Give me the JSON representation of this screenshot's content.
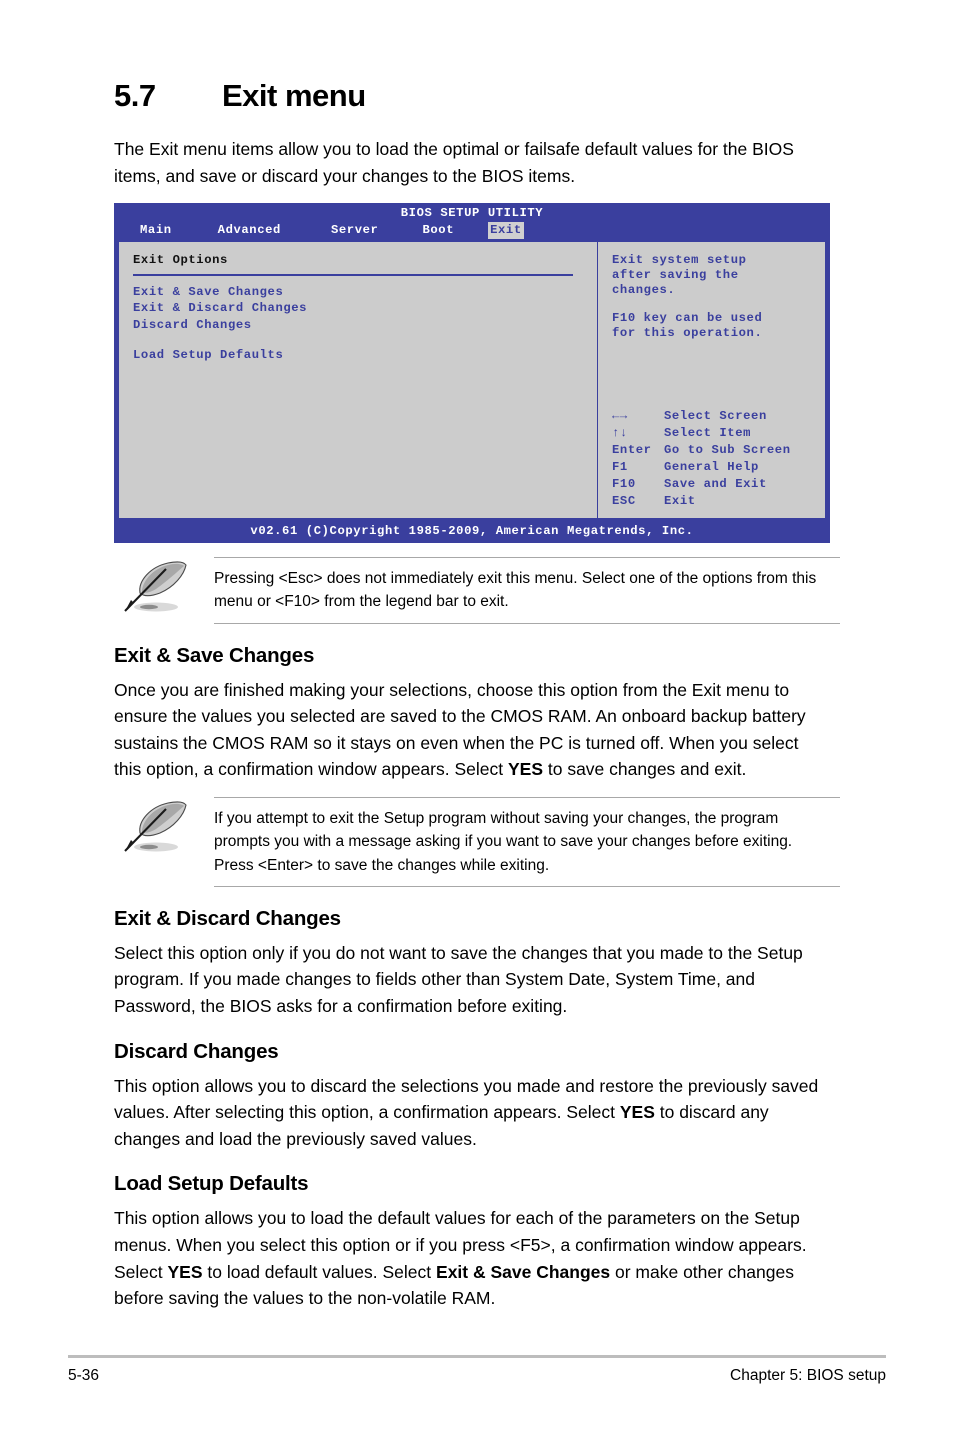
{
  "section": {
    "number": "5.7",
    "title": "Exit menu",
    "intro": "The Exit menu items allow you to load the optimal or failsafe default values for the BIOS items, and save or discard your changes to the BIOS items."
  },
  "bios": {
    "utility_title": "BIOS SETUP UTILITY",
    "tabs": [
      {
        "label": "Main",
        "selected": false
      },
      {
        "label": "Advanced",
        "selected": false
      },
      {
        "label": "Server",
        "selected": false
      },
      {
        "label": "Boot",
        "selected": false
      },
      {
        "label": "Exit",
        "selected": true
      }
    ],
    "panel_title": "Exit Options",
    "options": [
      "Exit & Save Changes",
      "Exit & Discard Changes",
      "Discard Changes",
      "Load Setup Defaults"
    ],
    "help": {
      "line1": "Exit system setup",
      "line2": "after saving the",
      "line3": "changes.",
      "line4": "F10 key can be used",
      "line5": "for this operation."
    },
    "legend": [
      {
        "key": "←→",
        "desc": "Select Screen"
      },
      {
        "key": "↑↓",
        "desc": "Select Item"
      },
      {
        "key": "Enter",
        "desc": "Go to Sub Screen"
      },
      {
        "key": "F1",
        "desc": "General Help"
      },
      {
        "key": "F10",
        "desc": "Save and Exit"
      },
      {
        "key": "ESC",
        "desc": "Exit"
      }
    ],
    "copyright": "v02.61 (C)Copyright 1985-2009, American Megatrends, Inc.",
    "colors": {
      "header_blue": "#3a3f9e",
      "panel_gray": "#cccccc",
      "tab_highlight": "#d0d0d0"
    }
  },
  "notes": {
    "note1": "Pressing <Esc> does not immediately exit this menu. Select one of the options from this menu or <F10> from the legend bar to exit.",
    "note2": "If you attempt to exit the Setup program without saving your changes, the program prompts you with a message asking if you want to save your changes before exiting. Press <Enter> to save the changes while exiting."
  },
  "sections": [
    {
      "heading": "Exit & Save Changes",
      "para_a": "Once you are finished making your selections, choose this option from the Exit menu to ensure the values you selected are saved to the CMOS RAM. An onboard backup battery sustains the CMOS RAM so it stays on even when the PC is turned off. When you select this option, a confirmation window appears. Select ",
      "bold_a": "YES",
      "para_b": " to save changes and exit."
    },
    {
      "heading": "Exit & Discard Changes",
      "para_a": "Select this option only if you do not want to save the changes that you made to the Setup program. If you made changes to fields other than System Date, System Time, and Password, the BIOS asks for a confirmation before exiting."
    },
    {
      "heading": "Discard Changes",
      "para_a": "This option allows you to discard the selections you made and restore the previously saved values. After selecting this option, a confirmation appears. Select ",
      "bold_a": "YES",
      "para_b": " to discard any changes and load the previously saved values."
    },
    {
      "heading": "Load Setup Defaults",
      "para_a": "This option allows you to load the default values for each of the parameters on the Setup menus. When you select this option or if you press <F5>, a confirmation window appears. Select ",
      "bold_a": "YES",
      "para_b": " to load default values. Select ",
      "bold_b": "Exit & Save Changes",
      "para_c": " or make other changes before saving the values to the non-volatile RAM."
    }
  ],
  "page_footer": {
    "page_number": "5-36",
    "chapter": "Chapter 5: BIOS setup"
  }
}
